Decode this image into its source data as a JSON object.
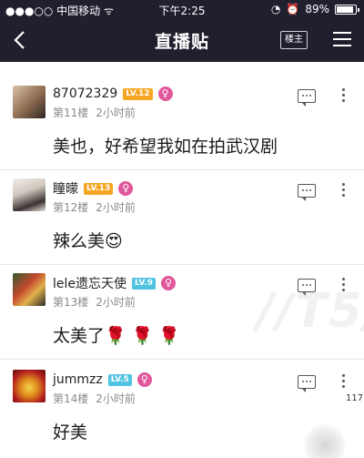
{
  "status_bar": {
    "carrier": "中国移动",
    "time": "下午2:25",
    "battery": "89%",
    "battery_level": 0.89
  },
  "nav": {
    "title": "直播贴",
    "op_only_label": "楼主"
  },
  "posts": [
    {
      "username": "87072329",
      "level": "LV.12",
      "gender_symbol": "♀",
      "floor": "第11楼",
      "time": "2小时前",
      "content": "美也，好希望我如在拍武汉剧",
      "level_color": "#f5a623"
    },
    {
      "username": "瞳曚",
      "level": "LV.13",
      "gender_symbol": "♀",
      "floor": "第12楼",
      "time": "2小时前",
      "content": "辣么美😍",
      "level_color": "#f5a623"
    },
    {
      "username": "lele遗忘天使",
      "level": "LV.9",
      "gender_symbol": "♀",
      "floor": "第13楼",
      "time": "2小时前",
      "content": "太美了🌹 🌹 🌹",
      "level_color": "#4fc3e0"
    },
    {
      "username": "jummzz",
      "level": "LV.5",
      "gender_symbol": "♀",
      "floor": "第14楼",
      "time": "2小时前",
      "content": "好美",
      "level_color": "#4fc3e0"
    }
  ],
  "corner_text": "117"
}
